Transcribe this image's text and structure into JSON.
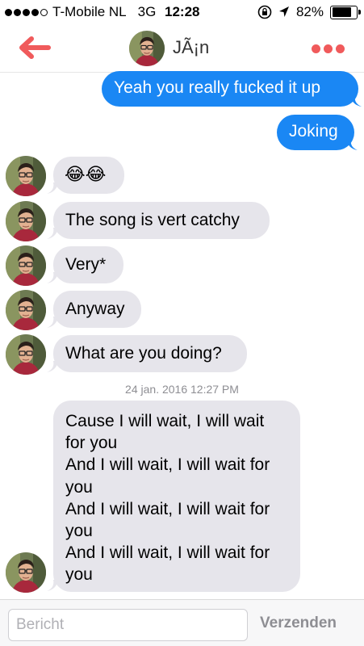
{
  "status_bar": {
    "carrier": "T-Mobile NL",
    "network": "3G",
    "time": "12:28",
    "battery": "82%",
    "battery_level": 0.82
  },
  "nav": {
    "contact_name": "JÃ¡n",
    "back_icon": "arrow-left-icon",
    "more_icon": "three-dots-icon",
    "accent_color": "#f05a5b"
  },
  "messages": {
    "m1": "Yeah you really fucked it up",
    "m2": "Joking",
    "m3": "😂😂",
    "m4": "The song is vert catchy",
    "m5": "Very*",
    "m6": "Anyway",
    "m7": "What are you doing?",
    "timestamp": "24 jan. 2016 12:27 PM",
    "m8_lines": [
      "Cause I will wait, I will wait",
      "for you",
      "And I will wait, I will wait for",
      "you",
      "And I will wait, I will wait for",
      "you",
      "And I will wait, I will wait for",
      "you"
    ]
  },
  "colors": {
    "outgoing_bubble": "#1a87f4",
    "incoming_bubble": "#e6e5eb"
  },
  "composer": {
    "placeholder": "Bericht",
    "value": "",
    "send_label": "Verzenden"
  }
}
